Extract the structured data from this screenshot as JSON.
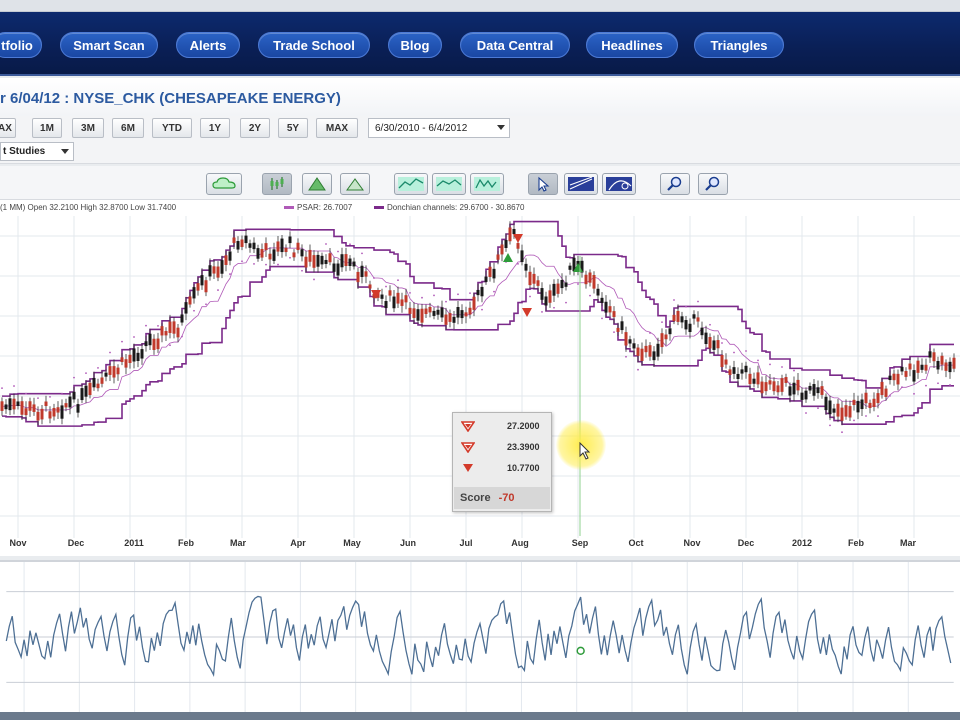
{
  "nav": {
    "items": [
      {
        "label": "tfolio"
      },
      {
        "label": "Smart Scan"
      },
      {
        "label": "Alerts"
      },
      {
        "label": "Trade School"
      },
      {
        "label": "Blog"
      },
      {
        "label": "Data Central"
      },
      {
        "label": "Headlines"
      },
      {
        "label": "Triangles"
      }
    ]
  },
  "header": {
    "title": "r 6/04/12 : NYSE_CHK (CHESAPEAKE ENERGY)"
  },
  "range": {
    "buttons": [
      "AX",
      "1M",
      "3M",
      "6M",
      "YTD",
      "1Y",
      "2Y",
      "5Y",
      "MAX"
    ],
    "date_range": "6/30/2010 - 6/4/2012"
  },
  "studies": {
    "label": "t Studies"
  },
  "legend": {
    "ohlc": "(1 MM)  Open 32.2100  High 32.8700  Low 31.7400",
    "psar": "PSAR: 26.7007",
    "donchian": "Donchian channels: 29.6700 - 30.8670"
  },
  "axis": {
    "months": [
      "Nov",
      "Dec",
      "2011",
      "Feb",
      "Mar",
      "Apr",
      "May",
      "Jun",
      "Jul",
      "Aug",
      "Sep",
      "Oct",
      "Nov",
      "Dec",
      "2012",
      "Feb",
      "Mar"
    ]
  },
  "score_box": {
    "rows": [
      "27.2000",
      "23.3900",
      "10.7700"
    ],
    "score_label": "Score",
    "score_value": "-70"
  },
  "colors": {
    "nav_bg": "#0a1f55",
    "nav_button": "#1f52b3",
    "title": "#2c5aa0",
    "donchian": "#7b2a8a",
    "psar": "#b05ab8",
    "candle_up": "#1a1a1a",
    "candle_down": "#c0392b",
    "osc_line": "#4d6f94",
    "signal_up": "#2e9b3a",
    "signal_down": "#d33a2a"
  }
}
